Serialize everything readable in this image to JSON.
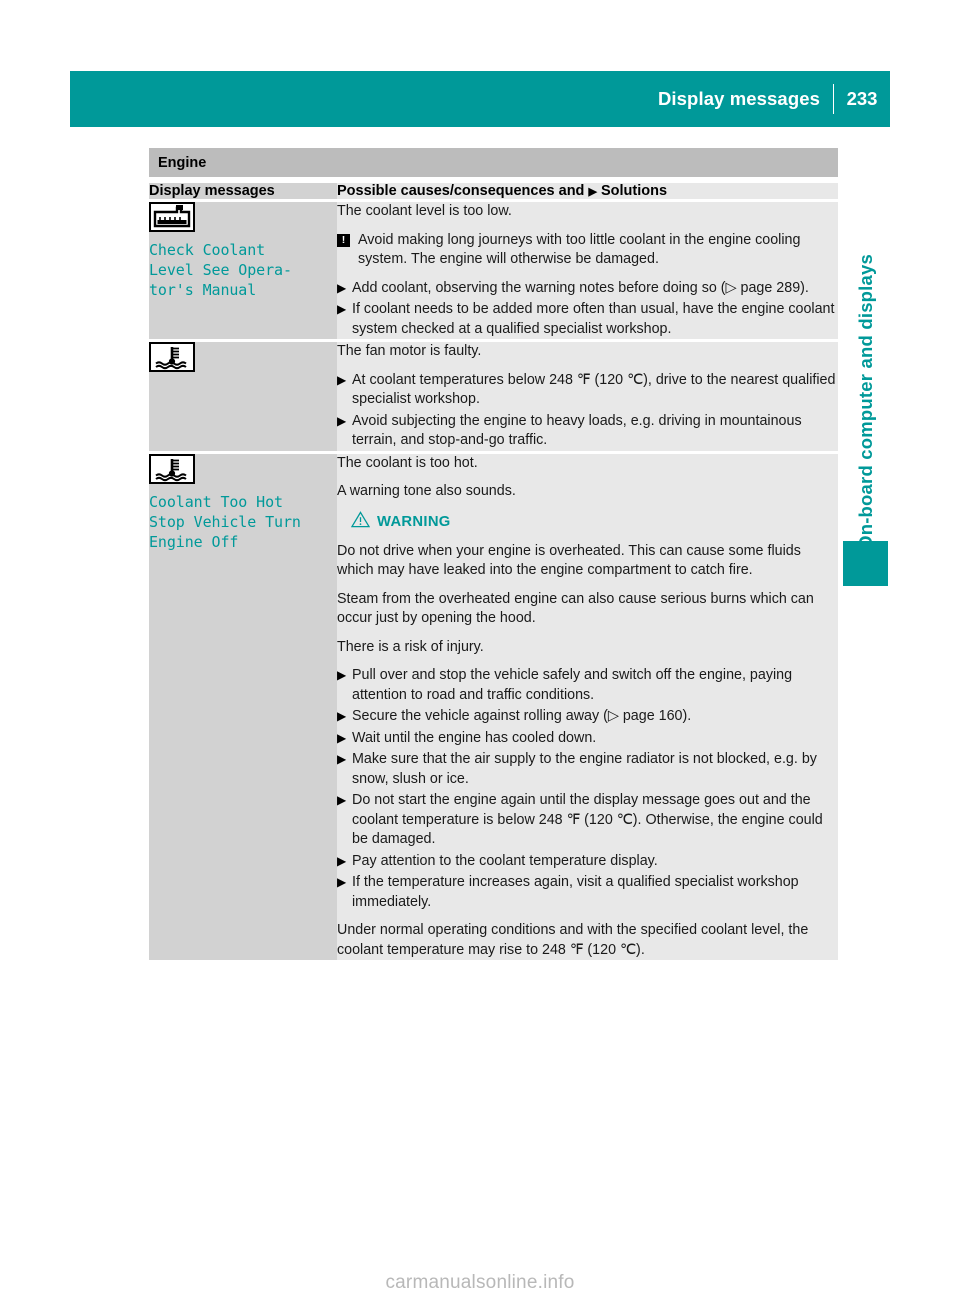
{
  "header": {
    "title": "Display messages",
    "page_number": "233"
  },
  "side_tab": {
    "label": "On-board computer and displays",
    "accent_color": "#009999"
  },
  "section": {
    "band_title": "Engine"
  },
  "table": {
    "columns": {
      "left": "Display messages",
      "right_prefix": "Possible causes/consequences and",
      "right_bullet": "▶",
      "right_suffix": "Solutions"
    },
    "rows": [
      {
        "icon_name": "coolant-reservoir-icon",
        "display_text": "Check Coolant\nLevel See Opera-\ntor's Manual",
        "cause": "The coolant level is too low.",
        "notice": {
          "marker": "!",
          "text": "Avoid making long journeys with too little coolant in the engine cooling system. The engine will otherwise be damaged."
        },
        "solutions": [
          "Add coolant, observing the warning notes before doing so (▷ page 289).",
          "If coolant needs to be added more often than usual, have the engine coolant system checked at a qualified specialist workshop."
        ]
      },
      {
        "icon_name": "coolant-temperature-icon",
        "display_text": "",
        "cause": "The fan motor is faulty.",
        "solutions": [
          "At coolant temperatures below 248 ℉ (120 ℃), drive to the nearest qualified specialist workshop.",
          "Avoid subjecting the engine to heavy loads, e.g. driving in mountainous terrain, and stop-and-go traffic."
        ]
      },
      {
        "icon_name": "coolant-temperature-icon",
        "display_text": "Coolant Too Hot\nStop Vehicle Turn\nEngine Off",
        "cause": "The coolant is too hot.",
        "cause_extra": "A warning tone also sounds.",
        "warning": {
          "label": "WARNING",
          "paragraphs": [
            "Do not drive when your engine is overheated. This can cause some fluids which may have leaked into the engine compartment to catch fire.",
            "Steam from the overheated engine can also cause serious burns which can occur just by opening the hood.",
            "There is a risk of injury."
          ]
        },
        "solutions": [
          "Pull over and stop the vehicle safely and switch off the engine, paying attention to road and traffic conditions.",
          "Secure the vehicle against rolling away (▷ page 160).",
          "Wait until the engine has cooled down.",
          "Make sure that the air supply to the engine radiator is not blocked, e.g. by snow, slush or ice.",
          "Do not start the engine again until the display message goes out and the coolant temperature is below 248 ℉ (120 ℃). Otherwise, the engine could be damaged.",
          "Pay attention to the coolant temperature display.",
          "If the temperature increases again, visit a qualified specialist workshop immediately."
        ],
        "closing": "Under normal operating conditions and with the specified coolant level, the coolant temperature may rise to 248 ℉ (120 ℃)."
      }
    ]
  },
  "footer": {
    "watermark": "carmanualsonline.info"
  }
}
